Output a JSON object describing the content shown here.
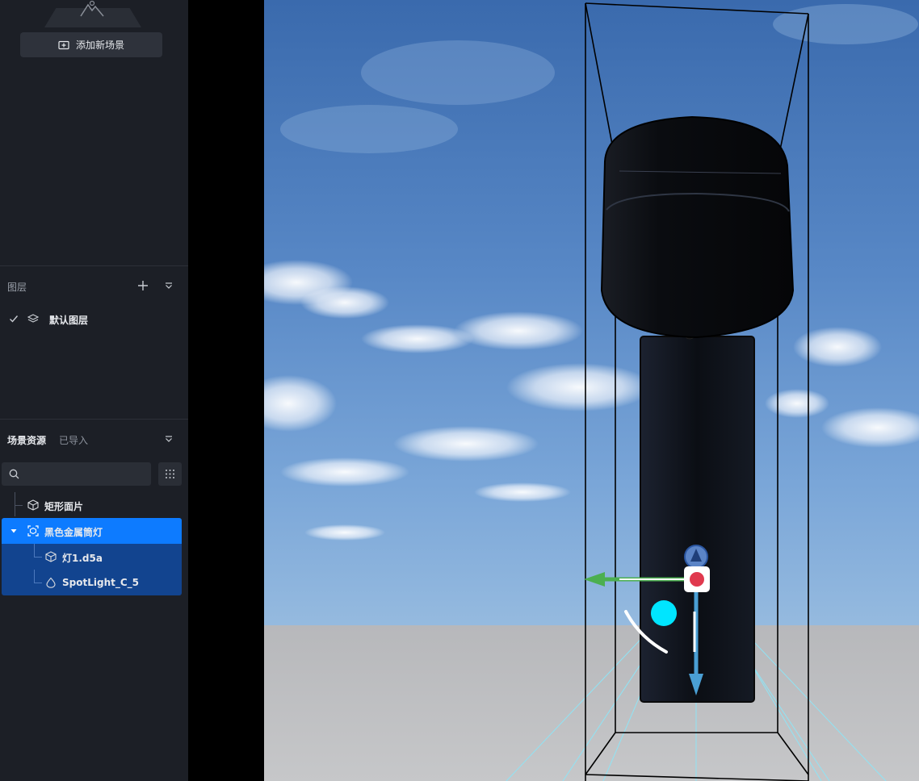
{
  "sidebar": {
    "add_scene_label": "添加新场景",
    "layers": {
      "title": "图层",
      "items": [
        {
          "label": "默认图层",
          "checked": true
        }
      ]
    },
    "assets": {
      "title": "场景资源",
      "tab_imported": "已导入",
      "search_placeholder": "",
      "tree": [
        {
          "label": "矩形面片",
          "icon": "cube-icon",
          "level": 0
        },
        {
          "label": "黑色金属筒灯",
          "icon": "group-icon",
          "level": 0,
          "expanded": true,
          "selected": true
        },
        {
          "label": "灯1.d5a",
          "icon": "cube-icon",
          "level": 1
        },
        {
          "label": "SpotLight_C_5",
          "icon": "light-drop-icon",
          "level": 1
        }
      ]
    }
  },
  "colors": {
    "panel_bg": "#1c1f26",
    "selected_row": "#0d7bff",
    "child_row": "#12448f",
    "gizmo_x": "#4caf50",
    "gizmo_z": "#4a9fd4",
    "gizmo_center": "#e0394e",
    "light_handle": "#00e5ff"
  }
}
